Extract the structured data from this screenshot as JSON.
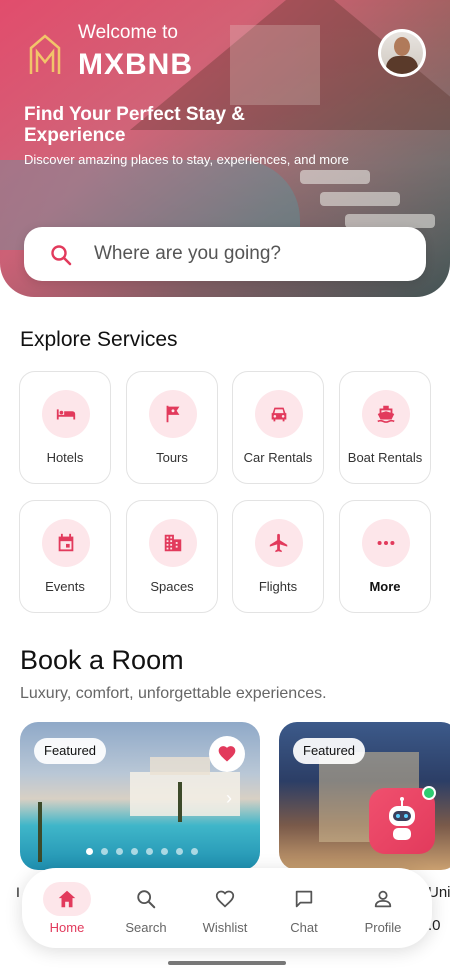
{
  "header": {
    "welcome": "Welcome to",
    "brand": "MXBNB",
    "hero_title": "Find Your Perfect Stay & Experience",
    "hero_subtitle": "Discover amazing places to stay, experiences, and more"
  },
  "search": {
    "placeholder": "Where are you going?"
  },
  "services": {
    "title": "Explore Services",
    "items": [
      {
        "label": "Hotels",
        "icon": "bed-icon"
      },
      {
        "label": "Tours",
        "icon": "flag-icon"
      },
      {
        "label": "Car Rentals",
        "icon": "car-icon"
      },
      {
        "label": "Boat Rentals",
        "icon": "boat-icon"
      },
      {
        "label": "Events",
        "icon": "calendar-icon"
      },
      {
        "label": "Spaces",
        "icon": "building-icon"
      },
      {
        "label": "Flights",
        "icon": "airplane-icon"
      },
      {
        "label": "More",
        "icon": "more-icon"
      }
    ]
  },
  "rooms": {
    "title": "Book a Room",
    "subtitle": "Luxury, comfort, unforgettable experiences.",
    "cards": [
      {
        "badge": "Featured",
        "favorited": true,
        "slide_count": 8,
        "active_slide": 1
      },
      {
        "badge": "Featured"
      }
    ],
    "peek_left": "I",
    "peek_right": "Uni",
    "peek_right_2": ".0"
  },
  "nav": {
    "items": [
      {
        "label": "Home",
        "icon": "home-icon",
        "active": true
      },
      {
        "label": "Search",
        "icon": "search-icon",
        "active": false
      },
      {
        "label": "Wishlist",
        "icon": "heart-icon",
        "active": false
      },
      {
        "label": "Chat",
        "icon": "chat-icon",
        "active": false
      },
      {
        "label": "Profile",
        "icon": "person-icon",
        "active": false
      }
    ]
  },
  "colors": {
    "accent": "#e23a5c",
    "accent_soft": "#fde6ea",
    "online": "#2ecc71"
  }
}
